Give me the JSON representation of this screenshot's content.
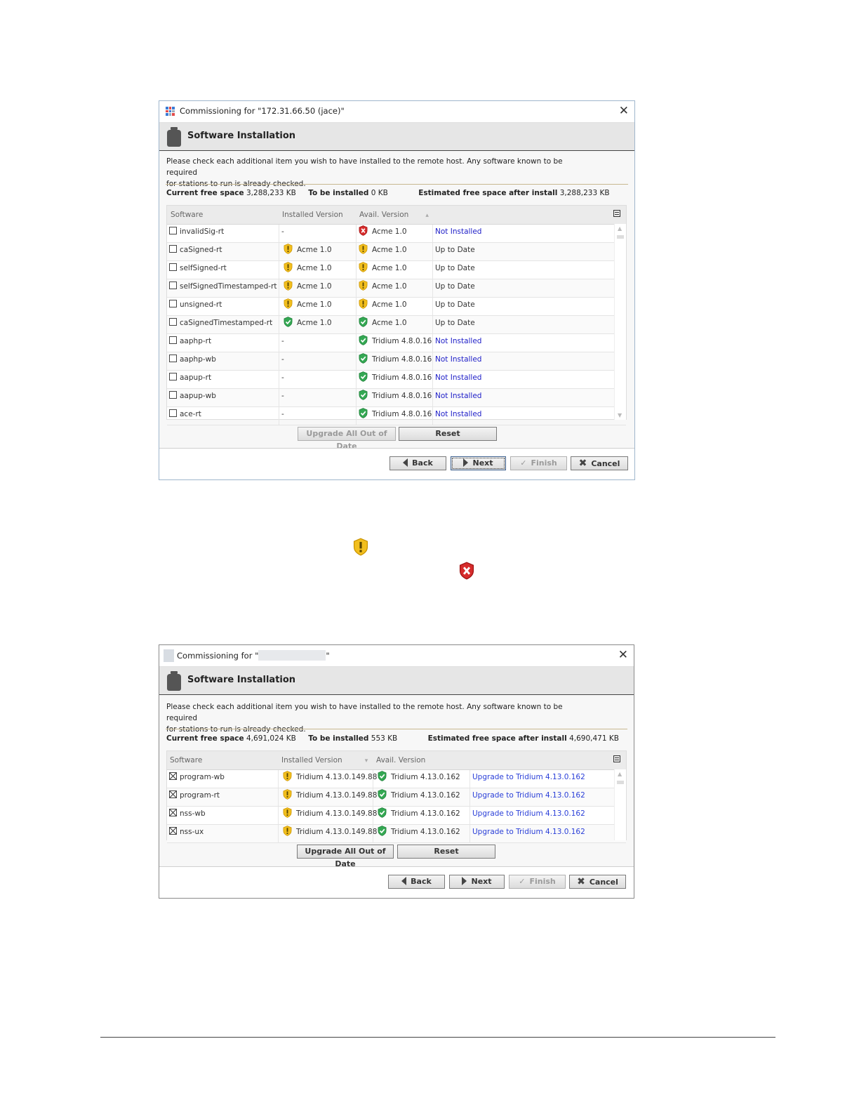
{
  "dialog1": {
    "title": "Commissioning for \"172.31.66.50 (jace)\"",
    "header": "Software Installation",
    "description": [
      "Please check each additional item you wish to have installed to the remote host. Any software known to be required",
      "for stations to run is already checked."
    ],
    "space": {
      "current_label": "Current free space",
      "current_value": "3,288,233 KB",
      "install_label": "To be installed",
      "install_value": "0 KB",
      "estimated_label": "Estimated free space after install",
      "estimated_value": "3,288,233 KB"
    },
    "columns": [
      "Software",
      "Installed Version",
      "Avail. Version",
      ""
    ],
    "rows": [
      {
        "name": "invalidSig-rt",
        "installed": "-",
        "installed_icon": "",
        "avail": "Acme 1.0",
        "avail_icon": "red-x-shield-icon",
        "status": "Not Installed",
        "link": true
      },
      {
        "name": "caSigned-rt",
        "installed": "Acme 1.0",
        "installed_icon": "yellow-warning-shield-icon",
        "avail": "Acme 1.0",
        "avail_icon": "yellow-warning-shield-icon",
        "status": "Up to Date",
        "link": false
      },
      {
        "name": "selfSigned-rt",
        "installed": "Acme 1.0",
        "installed_icon": "yellow-warning-shield-icon",
        "avail": "Acme 1.0",
        "avail_icon": "yellow-warning-shield-icon",
        "status": "Up to Date",
        "link": false
      },
      {
        "name": "selfSignedTimestamped-rt",
        "installed": "Acme 1.0",
        "installed_icon": "yellow-warning-shield-icon",
        "avail": "Acme 1.0",
        "avail_icon": "yellow-warning-shield-icon",
        "status": "Up to Date",
        "link": false
      },
      {
        "name": "unsigned-rt",
        "installed": "Acme 1.0",
        "installed_icon": "yellow-warning-shield-icon",
        "avail": "Acme 1.0",
        "avail_icon": "yellow-warning-shield-icon",
        "status": "Up to Date",
        "link": false
      },
      {
        "name": "caSignedTimestamped-rt",
        "installed": "Acme 1.0",
        "installed_icon": "green-check-shield-icon",
        "avail": "Acme 1.0",
        "avail_icon": "green-check-shield-icon",
        "status": "Up to Date",
        "link": false
      },
      {
        "name": "aaphp-rt",
        "installed": "-",
        "installed_icon": "",
        "avail": "Tridium 4.8.0.16",
        "avail_icon": "green-check-shield-icon",
        "status": "Not Installed",
        "link": true
      },
      {
        "name": "aaphp-wb",
        "installed": "-",
        "installed_icon": "",
        "avail": "Tridium 4.8.0.16",
        "avail_icon": "green-check-shield-icon",
        "status": "Not Installed",
        "link": true
      },
      {
        "name": "aapup-rt",
        "installed": "-",
        "installed_icon": "",
        "avail": "Tridium 4.8.0.16",
        "avail_icon": "green-check-shield-icon",
        "status": "Not Installed",
        "link": true
      },
      {
        "name": "aapup-wb",
        "installed": "-",
        "installed_icon": "",
        "avail": "Tridium 4.8.0.16",
        "avail_icon": "green-check-shield-icon",
        "status": "Not Installed",
        "link": true
      },
      {
        "name": "ace-rt",
        "installed": "-",
        "installed_icon": "",
        "avail": "Tridium 4.8.0.16",
        "avail_icon": "green-check-shield-icon",
        "status": "Not Installed",
        "link": true
      }
    ],
    "upgrade_all_label": "Upgrade All Out of Date",
    "reset_label": "Reset",
    "back_label": "Back",
    "next_label": "Next",
    "finish_label": "Finish",
    "cancel_label": "Cancel"
  },
  "legend_icons": {
    "warning": "yellow-warning-shield-icon",
    "error": "red-x-shield-icon"
  },
  "dialog2": {
    "title_prefix": "Commissioning for \"",
    "title_suffix": "\"",
    "header": "Software Installation",
    "description": [
      "Please check each additional item you wish to have installed to the remote host. Any software known to be required",
      "for stations to run is already checked."
    ],
    "space": {
      "current_label": "Current free space",
      "current_value": "4,691,024 KB",
      "install_label": "To be installed",
      "install_value": "553 KB",
      "estimated_label": "Estimated free space after install",
      "estimated_value": "4,690,471 KB"
    },
    "columns": [
      "Software",
      "Installed Version",
      "Avail. Version",
      ""
    ],
    "rows": [
      {
        "name": "program-wb",
        "installed": "Tridium 4.13.0.149.88",
        "avail": "Tridium 4.13.0.162",
        "status": "Upgrade to Tridium 4.13.0.162"
      },
      {
        "name": "program-rt",
        "installed": "Tridium 4.13.0.149.88",
        "avail": "Tridium 4.13.0.162",
        "status": "Upgrade to Tridium 4.13.0.162"
      },
      {
        "name": "nss-wb",
        "installed": "Tridium 4.13.0.149.88",
        "avail": "Tridium 4.13.0.162",
        "status": "Upgrade to Tridium 4.13.0.162"
      },
      {
        "name": "nss-ux",
        "installed": "Tridium 4.13.0.149.88",
        "avail": "Tridium 4.13.0.162",
        "status": "Upgrade to Tridium 4.13.0.162"
      }
    ],
    "upgrade_all_label": "Upgrade All Out of Date",
    "reset_label": "Reset",
    "back_label": "Back",
    "next_label": "Next",
    "finish_label": "Finish",
    "cancel_label": "Cancel"
  },
  "colors": {
    "link": "#2020c8",
    "warning_shield": "#f2bf1e",
    "ok_shield": "#34a853",
    "error_shield": "#d62c2c"
  }
}
